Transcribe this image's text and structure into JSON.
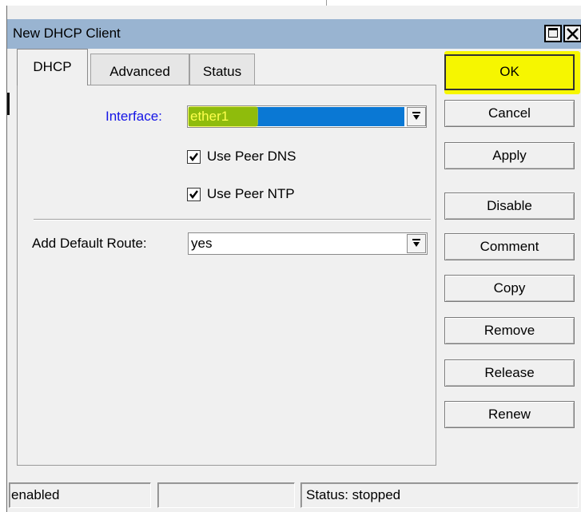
{
  "window": {
    "title": "New DHCP Client"
  },
  "tabs": [
    {
      "label": "DHCP",
      "active": true
    },
    {
      "label": "Advanced",
      "active": false
    },
    {
      "label": "Status",
      "active": false
    }
  ],
  "form": {
    "interface_label": "Interface:",
    "interface_value": "ether1",
    "use_peer_dns_label": "Use Peer DNS",
    "use_peer_dns_checked": true,
    "use_peer_ntp_label": "Use Peer NTP",
    "use_peer_ntp_checked": true,
    "add_default_route_label": "Add Default Route:",
    "add_default_route_value": "yes"
  },
  "buttons": {
    "ok": "OK",
    "cancel": "Cancel",
    "apply": "Apply",
    "disable": "Disable",
    "comment": "Comment",
    "copy": "Copy",
    "remove": "Remove",
    "release": "Release",
    "renew": "Renew"
  },
  "statusbar": {
    "state": "enabled",
    "middle": "",
    "status": "Status: stopped"
  },
  "colors": {
    "titlebar": "#99b4d1",
    "highlight_yellow": "#f7f700",
    "selection_blue": "#0a78d4",
    "label_blue": "#1414e6"
  }
}
